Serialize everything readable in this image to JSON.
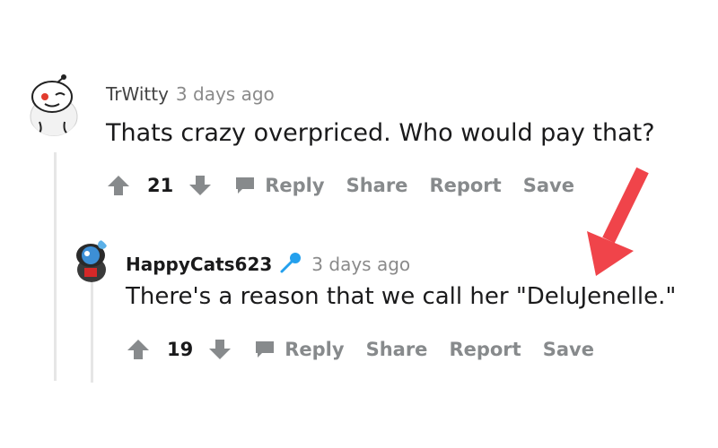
{
  "comments": [
    {
      "username": "TrWitty",
      "timestamp": "3 days ago",
      "body": "Thats crazy overpriced. Who would pay that?",
      "votes": "21",
      "actions": {
        "reply": "Reply",
        "share": "Share",
        "report": "Report",
        "save": "Save"
      }
    },
    {
      "username": "HappyCats623",
      "timestamp": "3 days ago",
      "body": "There's a reason that we call her \"DeluJenelle.\"",
      "votes": "19",
      "actions": {
        "reply": "Reply",
        "share": "Share",
        "report": "Report",
        "save": "Save"
      }
    }
  ],
  "colors": {
    "arrow": "#f0444a",
    "icon_gray": "#878a8c",
    "thread": "#e6e6e6",
    "mic": "#24a0ed"
  },
  "icons": [
    "upvote-icon",
    "downvote-icon",
    "reply-bubble-icon",
    "microphone-icon",
    "annotation-arrow"
  ]
}
